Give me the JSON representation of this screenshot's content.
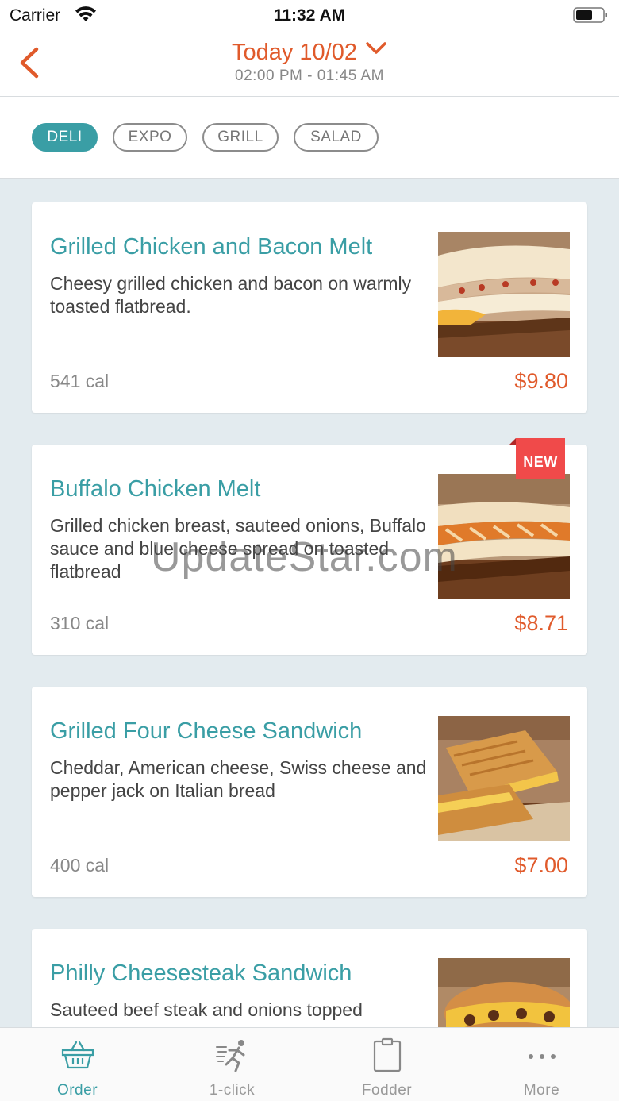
{
  "status_bar": {
    "carrier": "Carrier",
    "time": "11:32 AM"
  },
  "header": {
    "date_title": "Today 10/02",
    "hours": "02:00 PM - 01:45 AM"
  },
  "categories": [
    {
      "label": "DELI",
      "active": true
    },
    {
      "label": "EXPO",
      "active": false
    },
    {
      "label": "GRILL",
      "active": false
    },
    {
      "label": "SALAD",
      "active": false
    }
  ],
  "menu_items": [
    {
      "name": "Grilled Chicken and Bacon Melt",
      "description": "Cheesy grilled chicken and bacon on warmly toasted flatbread.",
      "calories": "541 cal",
      "price": "$9.80",
      "badge": ""
    },
    {
      "name": "Buffalo Chicken Melt",
      "description": "Grilled chicken breast, sauteed onions, Buffalo sauce and blue cheese spread on toasted flatbread",
      "calories": "310 cal",
      "price": "$8.71",
      "badge": "NEW"
    },
    {
      "name": "Grilled Four Cheese Sandwich",
      "description": "Cheddar, American cheese, Swiss cheese and pepper jack on Italian bread",
      "calories": "400 cal",
      "price": "$7.00",
      "badge": ""
    },
    {
      "name": "Philly Cheesesteak Sandwich",
      "description": "Sauteed beef steak and onions topped",
      "calories": "",
      "price": "",
      "badge": ""
    }
  ],
  "watermark": "UpdateStar.com",
  "tab_bar": [
    {
      "label": "Order",
      "icon": "basket-icon",
      "active": true
    },
    {
      "label": "1-click",
      "icon": "running-person-icon",
      "active": false
    },
    {
      "label": "Fodder",
      "icon": "clipboard-icon",
      "active": false
    },
    {
      "label": "More",
      "icon": "more-dots-icon",
      "active": false
    }
  ],
  "colors": {
    "accent_teal": "#3a9ea5",
    "accent_orange": "#e05a2b",
    "badge_red": "#f04a4a",
    "list_background": "#e3ebef"
  }
}
